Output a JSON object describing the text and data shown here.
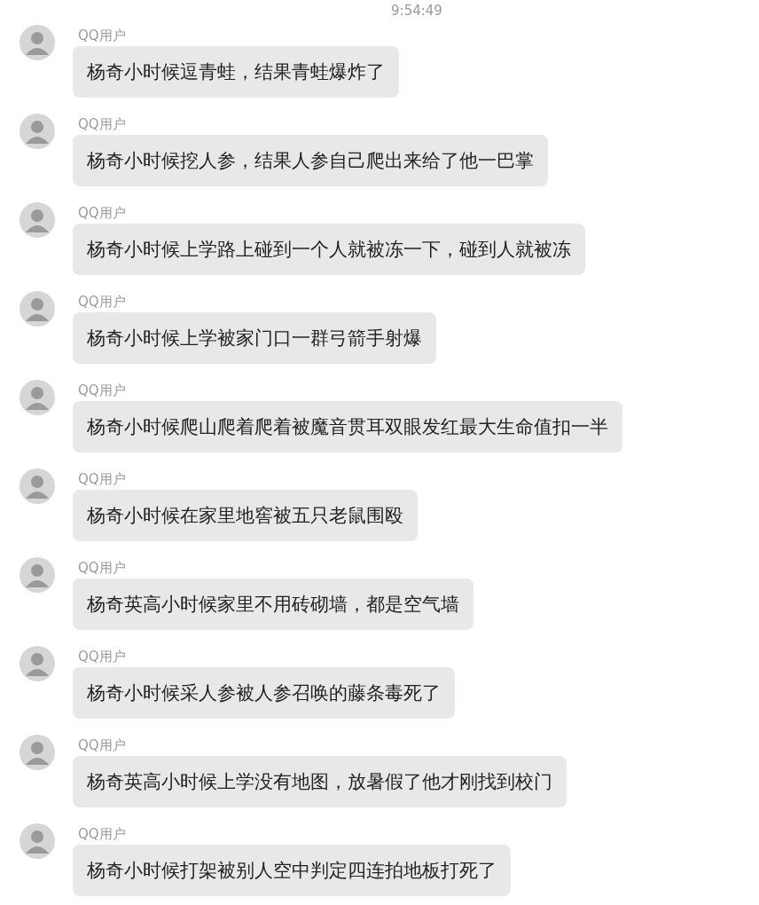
{
  "time": "9:54:49",
  "messages": [
    {
      "sender": "QQ用户",
      "text": "杨奇小时候逗青蛙，结果青蛙爆炸了"
    },
    {
      "sender": "QQ用户",
      "text": "杨奇小时候挖人参，结果人参自己爬出来给了他一巴掌"
    },
    {
      "sender": "QQ用户",
      "text": "杨奇小时候上学路上碰到一个人就被冻一下，碰到人就被冻"
    },
    {
      "sender": "QQ用户",
      "text": "杨奇小时候上学被家门口一群弓箭手射爆"
    },
    {
      "sender": "QQ用户",
      "text": "杨奇小时候爬山爬着爬着被魔音贯耳双眼发红最大生命值扣一半"
    },
    {
      "sender": "QQ用户",
      "text": "杨奇小时候在家里地窖被五只老鼠围殴"
    },
    {
      "sender": "QQ用户",
      "text": "杨奇英高小时候家里不用砖砌墙，都是空气墙"
    },
    {
      "sender": "QQ用户",
      "text": "杨奇小时候采人参被人参召唤的藤条毒死了"
    },
    {
      "sender": "QQ用户",
      "text": "杨奇英高小时候上学没有地图，放暑假了他才刚找到校门"
    },
    {
      "sender": "QQ用户",
      "text": "杨奇小时候打架被别人空中判定四连拍地板打死了"
    }
  ]
}
